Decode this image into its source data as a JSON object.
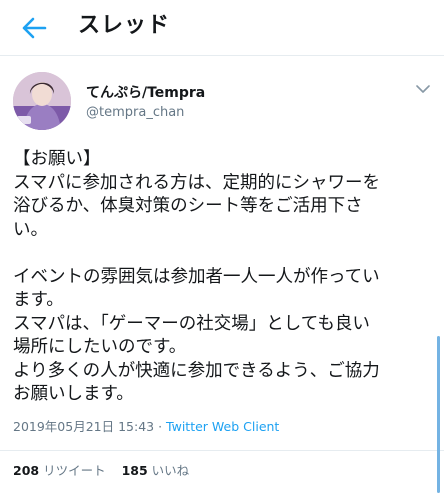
{
  "header": {
    "title": "スレッド"
  },
  "author": {
    "display_name": "てんぷら/Tempra",
    "handle": "@tempra_chan"
  },
  "tweet": {
    "lines": [
      "【お願い】",
      "スマパに参加される方は、定期的にシャワーを",
      "浴びるか、体臭対策のシート等をご活用下さ",
      "い。",
      "",
      "イベントの雰囲気は参加者一人一人が作ってい",
      "ます。",
      "スマパは、「ゲーマーの社交場」としても良い",
      "場所にしたいのです。",
      "より多くの人が快適に参加できるよう、ご協力",
      "お願いします。"
    ],
    "timestamp": "2019年05月21日 15:43",
    "separator": " · ",
    "client": "Twitter Web Client"
  },
  "stats": {
    "retweets_count": "208",
    "retweets_label": "リツイート",
    "likes_count": "185",
    "likes_label": "いいね"
  },
  "colors": {
    "accent": "#1da1f2",
    "text": "#14171a",
    "secondary": "#657786",
    "divider": "#e6ecf0"
  },
  "icons": {
    "back": "back-arrow-icon",
    "caret": "chevron-down-icon"
  }
}
